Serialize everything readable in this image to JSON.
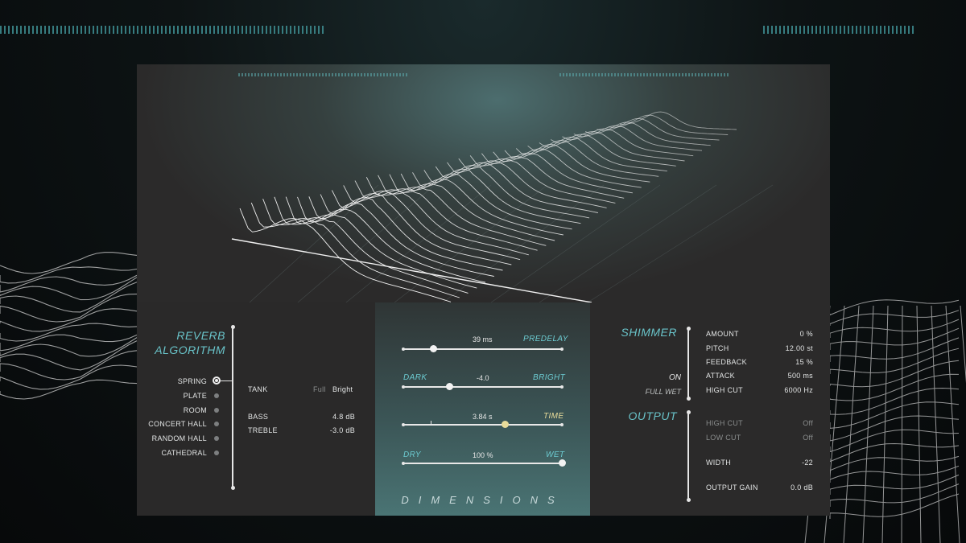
{
  "reverb": {
    "title_line1": "REVERB",
    "title_line2": "ALGORITHM",
    "algorithms": [
      "SPRING",
      "PLATE",
      "ROOM",
      "CONCERT HALL",
      "RANDOM HALL",
      "CATHEDRAL"
    ],
    "selected": "SPRING",
    "tank_label": "TANK",
    "tank_option_full": "Full",
    "tank_option_bright": "Bright",
    "bass_label": "BASS",
    "bass_value": "4.8 dB",
    "treble_label": "TREBLE",
    "treble_value": "-3.0 dB"
  },
  "center": {
    "predelay_label": "PREDELAY",
    "predelay_value": "39 ms",
    "predelay_position": 0.19,
    "dark_label": "DARK",
    "bright_label": "BRIGHT",
    "tone_value": "-4.0",
    "tone_position": 0.29,
    "time_label": "TIME",
    "time_value": "3.84 s",
    "time_position": 0.64,
    "dry_label": "DRY",
    "wet_label": "WET",
    "mix_value": "100 %",
    "mix_position": 1.0,
    "brand": "DIMENSIONS"
  },
  "shimmer": {
    "title": "SHIMMER",
    "on_label": "ON",
    "full_wet_label": "FULL WET",
    "params": [
      {
        "label": "AMOUNT",
        "value": "0 %"
      },
      {
        "label": "PITCH",
        "value": "12.00 st"
      },
      {
        "label": "FEEDBACK",
        "value": "15 %"
      },
      {
        "label": "ATTACK",
        "value": "500 ms"
      },
      {
        "label": "HIGH CUT",
        "value": "6000 Hz"
      }
    ]
  },
  "output": {
    "title": "OUTPUT",
    "high_cut_label": "HIGH CUT",
    "high_cut_value": "Off",
    "low_cut_label": "LOW CUT",
    "low_cut_value": "Off",
    "width_label": "WIDTH",
    "width_value": "-22",
    "gain_label": "OUTPUT GAIN",
    "gain_value": "0.0 dB"
  },
  "colors": {
    "accent_teal": "#69c3c9",
    "accent_gold": "#e9dc9a",
    "panel_bg": "#2b2a2a"
  }
}
